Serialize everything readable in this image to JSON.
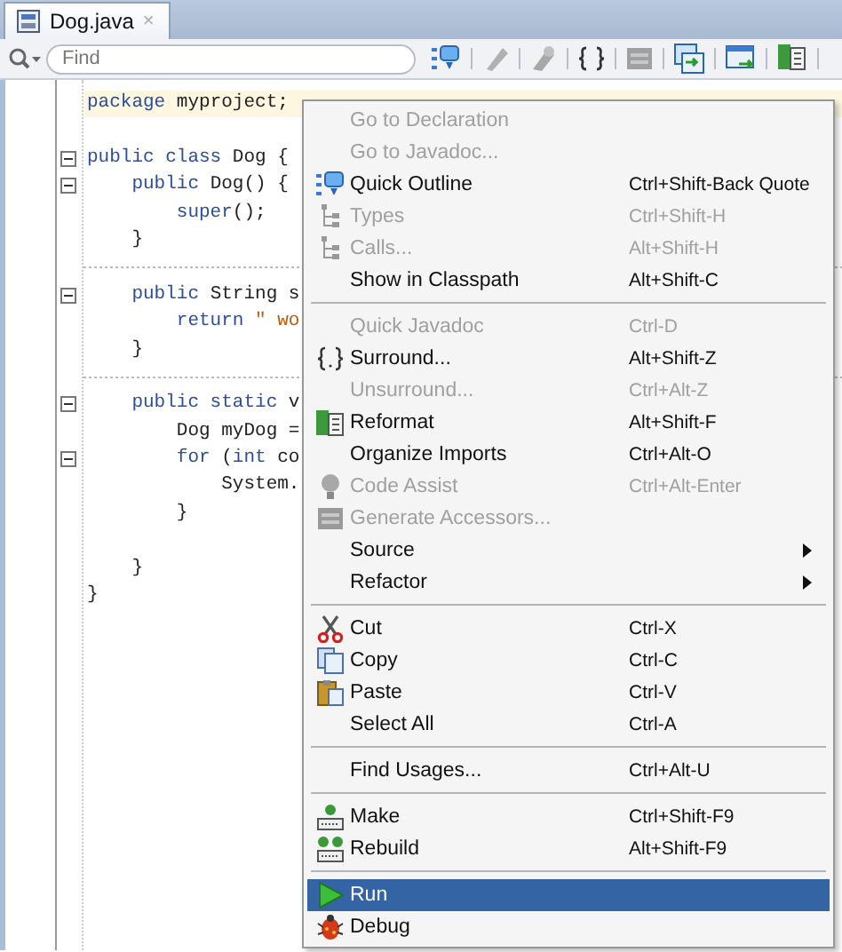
{
  "tab": {
    "title": "Dog.java",
    "close": "×",
    "selected": true
  },
  "toolbar": {
    "search": {
      "placeholder": "Find"
    }
  },
  "editor": {
    "sections": [
      {
        "method_separator": false,
        "lines": [
          {
            "fold": false,
            "highlighted": true,
            "segments": [
              {
                "kind": "keyword",
                "text": "package"
              },
              {
                "kind": "plain",
                "text": " myproject;"
              }
            ]
          }
        ]
      },
      {
        "method_separator": false,
        "lines": [
          {
            "fold": true,
            "highlighted": false,
            "segments": [
              {
                "kind": "keyword",
                "text": "public class"
              },
              {
                "kind": "plain",
                "text": " Dog {"
              }
            ]
          },
          {
            "fold": true,
            "highlighted": false,
            "segments": [
              {
                "kind": "keyword",
                "text": "    public"
              },
              {
                "kind": "plain",
                "text": " Dog() {"
              }
            ]
          },
          {
            "fold": false,
            "highlighted": false,
            "segments": [
              {
                "kind": "keyword",
                "text": "        super"
              },
              {
                "kind": "plain",
                "text": "();"
              }
            ]
          },
          {
            "fold": false,
            "highlighted": false,
            "segments": [
              {
                "kind": "plain",
                "text": "    }"
              }
            ]
          }
        ]
      },
      {
        "method_separator": true,
        "lines": [
          {
            "fold": true,
            "highlighted": false,
            "segments": [
              {
                "kind": "keyword",
                "text": "    public"
              },
              {
                "kind": "plain",
                "text": " String s"
              }
            ]
          },
          {
            "fold": false,
            "highlighted": false,
            "segments": [
              {
                "kind": "keyword",
                "text": "        return"
              },
              {
                "kind": "string",
                "text": " \" wo"
              }
            ]
          },
          {
            "fold": false,
            "highlighted": false,
            "segments": [
              {
                "kind": "plain",
                "text": "    }"
              }
            ]
          }
        ]
      },
      {
        "method_separator": true,
        "lines": [
          {
            "fold": true,
            "highlighted": false,
            "segments": [
              {
                "kind": "keyword",
                "text": "    public static"
              },
              {
                "kind": "plain",
                "text": " v"
              }
            ]
          },
          {
            "fold": false,
            "highlighted": false,
            "segments": [
              {
                "kind": "plain",
                "text": "        Dog myDog ="
              }
            ]
          },
          {
            "fold": true,
            "highlighted": false,
            "segments": [
              {
                "kind": "keyword",
                "text": "        for"
              },
              {
                "kind": "plain",
                "text": " ("
              },
              {
                "kind": "keyword",
                "text": "int"
              },
              {
                "kind": "plain",
                "text": " co"
              }
            ]
          },
          {
            "fold": false,
            "highlighted": false,
            "segments": [
              {
                "kind": "plain",
                "text": "            System."
              }
            ]
          },
          {
            "fold": false,
            "highlighted": false,
            "segments": [
              {
                "kind": "plain",
                "text": "        }"
              }
            ]
          }
        ]
      },
      {
        "method_separator": false,
        "lines": [
          {
            "fold": false,
            "highlighted": false,
            "segments": [
              {
                "kind": "plain",
                "text": "    }"
              }
            ]
          },
          {
            "fold": false,
            "highlighted": false,
            "segments": [
              {
                "kind": "plain",
                "text": "}"
              }
            ]
          }
        ]
      }
    ]
  },
  "context_menu": {
    "items": [
      {
        "kind": "item",
        "label": "Go to Declaration",
        "disabled": true,
        "selected": false
      },
      {
        "kind": "item",
        "label": "Go to Javadoc...",
        "disabled": true,
        "selected": false
      },
      {
        "kind": "item",
        "label": "Quick Outline",
        "shortcut": "Ctrl+Shift-Back Quote",
        "disabled": false,
        "selected": false
      },
      {
        "kind": "item",
        "label": "Types",
        "shortcut": "Ctrl+Shift-H",
        "disabled": true,
        "selected": false
      },
      {
        "kind": "item",
        "label": "Calls...",
        "shortcut": "Alt+Shift-H",
        "disabled": true,
        "selected": false
      },
      {
        "kind": "item",
        "label": "Show in Classpath",
        "shortcut": "Alt+Shift-C",
        "disabled": false,
        "selected": false
      },
      {
        "kind": "separator"
      },
      {
        "kind": "item",
        "label": "Quick Javadoc",
        "shortcut": "Ctrl-D",
        "disabled": true,
        "selected": false
      },
      {
        "kind": "item",
        "label": "Surround...",
        "shortcut": "Alt+Shift-Z",
        "disabled": false,
        "selected": false
      },
      {
        "kind": "item",
        "label": "Unsurround...",
        "shortcut": "Ctrl+Alt-Z",
        "disabled": true,
        "selected": false
      },
      {
        "kind": "item",
        "label": "Reformat",
        "shortcut": "Alt+Shift-F",
        "disabled": false,
        "selected": false
      },
      {
        "kind": "item",
        "label": "Organize Imports",
        "shortcut": "Ctrl+Alt-O",
        "disabled": false,
        "selected": false
      },
      {
        "kind": "item",
        "label": "Code Assist",
        "shortcut": "Ctrl+Alt-Enter",
        "disabled": true,
        "selected": false
      },
      {
        "kind": "item",
        "label": "Generate Accessors...",
        "disabled": true,
        "selected": false
      },
      {
        "kind": "submenu",
        "label": "Source",
        "disabled": false,
        "selected": false
      },
      {
        "kind": "submenu",
        "label": "Refactor",
        "disabled": false,
        "selected": false
      },
      {
        "kind": "separator"
      },
      {
        "kind": "item",
        "label": "Cut",
        "shortcut": "Ctrl-X",
        "disabled": false,
        "selected": false
      },
      {
        "kind": "item",
        "label": "Copy",
        "shortcut": "Ctrl-C",
        "disabled": false,
        "selected": false
      },
      {
        "kind": "item",
        "label": "Paste",
        "shortcut": "Ctrl-V",
        "disabled": false,
        "selected": false
      },
      {
        "kind": "item",
        "label": "Select All",
        "shortcut": "Ctrl-A",
        "disabled": false,
        "selected": false
      },
      {
        "kind": "separator"
      },
      {
        "kind": "item",
        "label": "Find Usages...",
        "shortcut": "Ctrl+Alt-U",
        "disabled": false,
        "selected": false
      },
      {
        "kind": "separator"
      },
      {
        "kind": "item",
        "label": "Make",
        "shortcut": "Ctrl+Shift-F9",
        "disabled": false,
        "selected": false
      },
      {
        "kind": "item",
        "label": "Rebuild",
        "shortcut": "Alt+Shift-F9",
        "disabled": false,
        "selected": false
      },
      {
        "kind": "separator"
      },
      {
        "kind": "item",
        "label": "Run",
        "disabled": false,
        "selected": true
      },
      {
        "kind": "item",
        "label": "Debug",
        "disabled": false,
        "selected": false
      }
    ]
  }
}
